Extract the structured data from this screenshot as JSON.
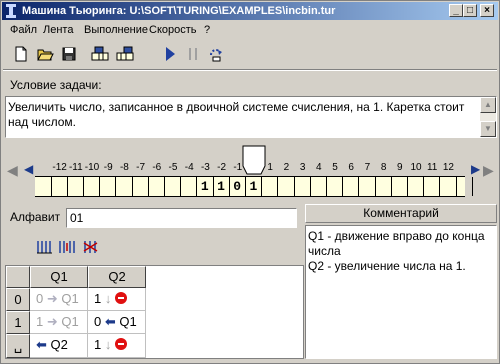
{
  "window": {
    "title": "Машина Тьюринга: U:\\SOFT\\TURING\\EXAMPLES\\incbin.tur",
    "minimize": "_",
    "maximize": "□",
    "close": "×"
  },
  "menu": [
    "Файл",
    "Лента",
    "Выполнение",
    "Скорость",
    "?"
  ],
  "toolbar": [
    "new-file-icon",
    "open-folder-icon",
    "save-icon",
    "tape-edit-icon",
    "tape-edit2-icon",
    "run-icon",
    "pause-icon",
    "step-icon"
  ],
  "task": {
    "label": "Условие задачи:",
    "text": "Увеличить число, записанное в двоичной системе счисления, на 1. Каретка стоит над числом."
  },
  "tape": {
    "positions": [
      "-12",
      "-11",
      "-10",
      "-9",
      "-8",
      "-7",
      "-6",
      "-5",
      "-4",
      "-3",
      "-2",
      "-1",
      "0",
      "1",
      "2",
      "3",
      "4",
      "5",
      "6",
      "7",
      "8",
      "9",
      "10",
      "11",
      "12"
    ],
    "cells": [
      "",
      "",
      "",
      "",
      "",
      "",
      "",
      "",
      "",
      "1",
      "1",
      "0",
      "1",
      "",
      "",
      "",
      "",
      "",
      "",
      "",
      "",
      "",
      "",
      "",
      "",
      "",
      ""
    ],
    "head_position": "0"
  },
  "alphabet": {
    "label": "Алфавит",
    "value": "01"
  },
  "state_tools": [
    "add-state-icon",
    "insert-state-icon",
    "delete-state-icon"
  ],
  "table": {
    "headers": [
      "Q1",
      "Q2"
    ],
    "rows": [
      {
        "symbol": "0",
        "q1": {
          "write": "0",
          "move": "right",
          "next": "Q1",
          "disabled": true
        },
        "q2": {
          "write": "1",
          "move": "stay",
          "next": "stop",
          "disabled": false
        }
      },
      {
        "symbol": "1",
        "q1": {
          "write": "1",
          "move": "right",
          "next": "Q1",
          "disabled": true
        },
        "q2": {
          "write": "0",
          "move": "left",
          "next": "Q1",
          "disabled": false
        }
      },
      {
        "symbol": "␣",
        "q1": {
          "write": "",
          "move": "left",
          "next": "Q2",
          "disabled": false
        },
        "q2": {
          "write": "1",
          "move": "stay",
          "next": "stop",
          "disabled": false
        }
      }
    ]
  },
  "comments": {
    "header": "Комментарий",
    "lines": [
      "Q1 - движение вправо до конца числа",
      "Q2 - увеличение числа на 1."
    ]
  }
}
